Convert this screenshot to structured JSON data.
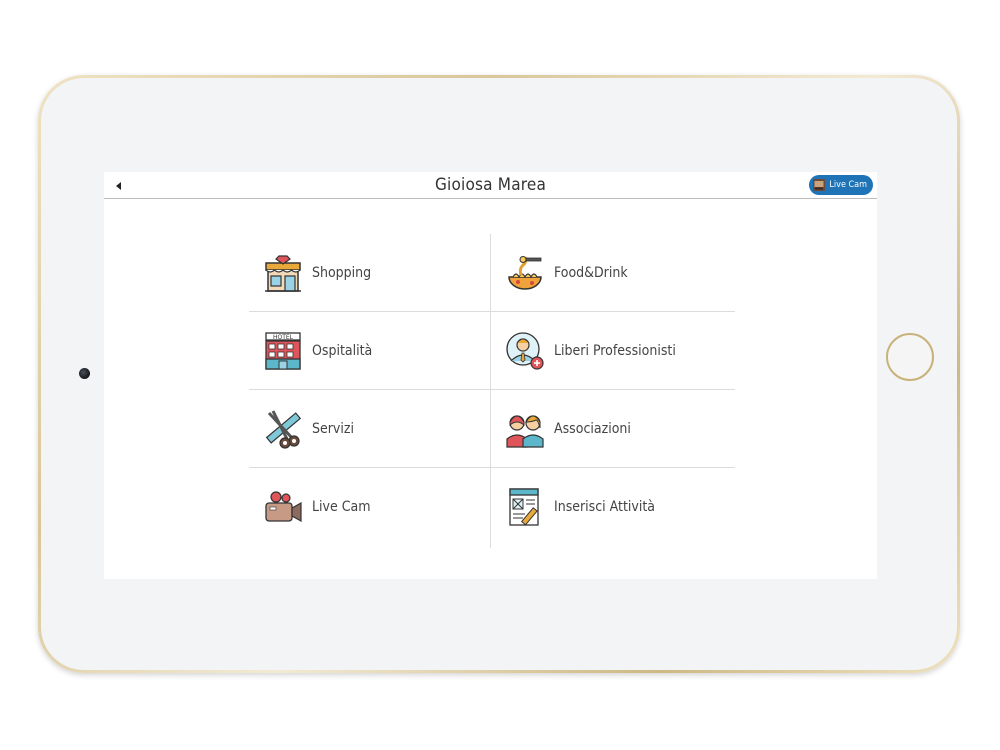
{
  "app": {
    "title": "Gioiosa Marea",
    "live_cam_button": "Live Cam"
  },
  "menu": {
    "items": [
      {
        "label": "Shopping",
        "icon": "storefront-icon"
      },
      {
        "label": "Food&Drink",
        "icon": "spaghetti-icon"
      },
      {
        "label": "Ospitalità",
        "icon": "hotel-icon"
      },
      {
        "label": "Liberi Professionisti",
        "icon": "professional-icon"
      },
      {
        "label": "Servizi",
        "icon": "scissors-comb-icon"
      },
      {
        "label": "Associazioni",
        "icon": "people-icon"
      },
      {
        "label": "Live Cam",
        "icon": "video-camera-icon"
      },
      {
        "label": "Inserisci Attività",
        "icon": "form-edit-icon"
      }
    ]
  },
  "colors": {
    "accent": "#1f73b7",
    "frame_gold": "#d9c79a",
    "screen_bg": "#f3f4f6"
  }
}
